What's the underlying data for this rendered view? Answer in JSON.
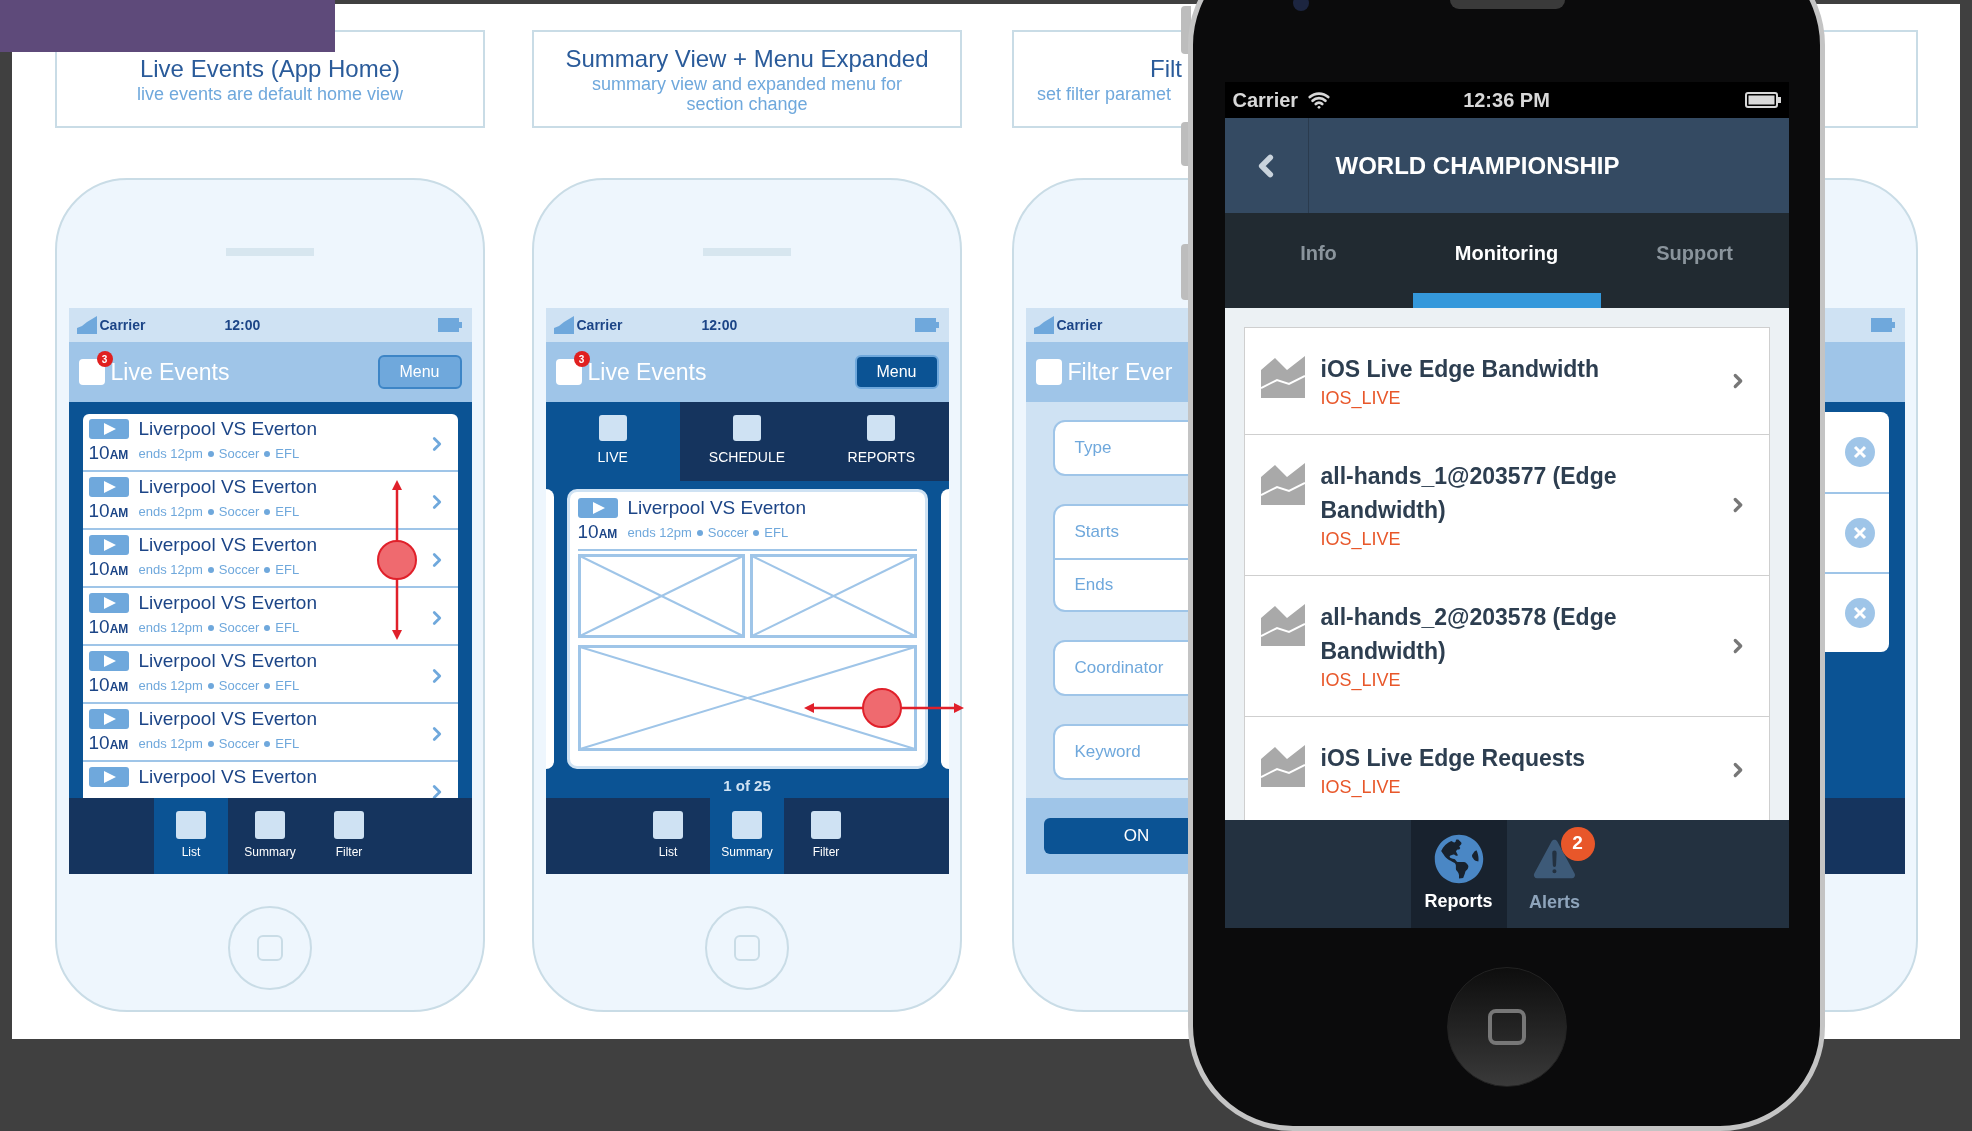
{
  "wireframes": [
    {
      "kind": "list",
      "callout": {
        "title": "Live Events (App Home)",
        "subtitle": "live events are default home view"
      },
      "status": {
        "carrier": "Carrier",
        "time": "12:00"
      },
      "header": {
        "title": "Live Events",
        "badge": "3",
        "menu": "Menu",
        "menu_expanded": false
      },
      "gesture": {
        "kind": "vertical"
      },
      "events": [
        {
          "title": "Liverpool VS Everton",
          "hour": "10",
          "meridiem": "AM",
          "details": [
            "ends 12pm",
            "Soccer",
            "EFL"
          ]
        },
        {
          "title": "Liverpool VS Everton",
          "hour": "10",
          "meridiem": "AM",
          "details": [
            "ends 12pm",
            "Soccer",
            "EFL"
          ]
        },
        {
          "title": "Liverpool VS Everton",
          "hour": "10",
          "meridiem": "AM",
          "details": [
            "ends 12pm",
            "Soccer",
            "EFL"
          ]
        },
        {
          "title": "Liverpool VS Everton",
          "hour": "10",
          "meridiem": "AM",
          "details": [
            "ends 12pm",
            "Soccer",
            "EFL"
          ]
        },
        {
          "title": "Liverpool VS Everton",
          "hour": "10",
          "meridiem": "AM",
          "details": [
            "ends 12pm",
            "Soccer",
            "EFL"
          ]
        },
        {
          "title": "Liverpool VS Everton",
          "hour": "10",
          "meridiem": "AM",
          "details": [
            "ends 12pm",
            "Soccer",
            "EFL"
          ]
        },
        {
          "title": "Liverpool VS Everton"
        }
      ],
      "tabs": [
        {
          "label": "List",
          "selected": true
        },
        {
          "label": "Summary",
          "selected": false
        },
        {
          "label": "Filter",
          "selected": false
        }
      ]
    },
    {
      "kind": "summary",
      "callout": {
        "title": "Summary View + Menu Expanded",
        "subtitle": "summary view and expanded menu for section change"
      },
      "status": {
        "carrier": "Carrier",
        "time": "12:00"
      },
      "header": {
        "title": "Live Events",
        "badge": "3",
        "menu": "Menu",
        "menu_expanded": true
      },
      "gesture": {
        "kind": "horizontal"
      },
      "menu": [
        {
          "label": "LIVE",
          "selected": true
        },
        {
          "label": "SCHEDULE",
          "selected": false
        },
        {
          "label": "REPORTS",
          "selected": false
        }
      ],
      "events": [
        {
          "title": "Liverpool VS Everton",
          "hour": "10",
          "meridiem": "AM",
          "details": [
            "ends 12pm",
            "Soccer",
            "EFL"
          ]
        }
      ],
      "pager": "1 of 25",
      "tabs": [
        {
          "label": "List",
          "selected": false
        },
        {
          "label": "Summary",
          "selected": true
        },
        {
          "label": "Filter",
          "selected": false
        }
      ]
    },
    {
      "kind": "filter",
      "callout": {
        "title": "Filt",
        "subtitle": "set filter paramet"
      },
      "status": {
        "carrier": "Carrier"
      },
      "header": {
        "title": "Filter Ever"
      },
      "field_groups": [
        [
          "Type"
        ],
        [
          "Starts",
          "Ends"
        ],
        [
          "Coordinator"
        ],
        [
          "Keyword"
        ]
      ],
      "button": "ON"
    },
    {
      "kind": "clear_list"
    }
  ],
  "device": {
    "status": {
      "carrier": "Carrier",
      "time": "12:36 PM"
    },
    "title": "WORLD CHAMPIONSHIP",
    "tabs": [
      {
        "label": "Info",
        "selected": false
      },
      {
        "label": "Monitoring",
        "selected": true
      },
      {
        "label": "Support",
        "selected": false
      }
    ],
    "reports": [
      {
        "title": "iOS Live Edge Bandwidth",
        "tag": "IOS_LIVE"
      },
      {
        "title": "all-hands_1@203577 (Edge Bandwidth)",
        "tag": "IOS_LIVE"
      },
      {
        "title": "all-hands_2@203578 (Edge Bandwidth)",
        "tag": "IOS_LIVE"
      },
      {
        "title": "iOS Live Edge Requests",
        "tag": "IOS_LIVE"
      }
    ],
    "tab_bar": [
      {
        "kind": "globe",
        "label": "Reports",
        "selected": true
      },
      {
        "kind": "alert",
        "label": "Alerts",
        "selected": false,
        "badge": "2"
      }
    ]
  }
}
